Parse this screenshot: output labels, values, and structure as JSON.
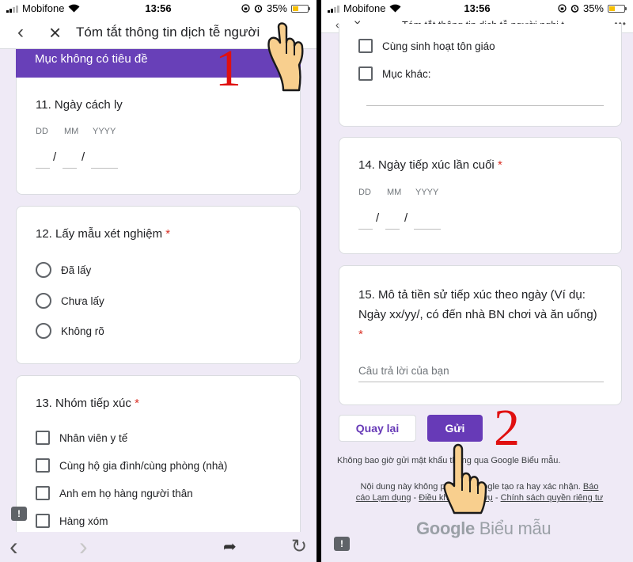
{
  "status_bar": {
    "carrier": "Mobifone",
    "time": "13:56",
    "battery": "35%",
    "battery_level": 0.35
  },
  "left": {
    "nav_title": "Tóm tắt thông tin dịch tễ người",
    "section_title": "Mục không có tiêu đề",
    "q11": {
      "title": "11. Ngày cách ly",
      "dd": "DD",
      "mm": "MM",
      "yyyy": "YYYY"
    },
    "q12": {
      "title": "12. Lấy mẫu xét nghiệm",
      "required": "*",
      "options": [
        "Đã lấy",
        "Chưa lấy",
        "Không rõ"
      ]
    },
    "q13": {
      "title": "13. Nhóm tiếp xúc",
      "required": "*",
      "options": [
        "Nhân viên y tế",
        "Cùng hộ gia đình/cùng phòng (nhà)",
        "Anh em họ hàng người thân",
        "Hàng xóm"
      ]
    },
    "toolbar": {
      "back": "‹",
      "forward": "›",
      "share": "➦",
      "reload": "↻"
    }
  },
  "right": {
    "nav_title": "Tóm tắt thông tin dịch tễ người nghi t...",
    "more": "•••",
    "q13_options": [
      "Cùng sinh hoạt tôn giáo",
      "Mục khác:"
    ],
    "q14": {
      "title": "14. Ngày tiếp xúc lần cuối",
      "required": "*",
      "dd": "DD",
      "mm": "MM",
      "yyyy": "YYYY"
    },
    "q15": {
      "title_line1": "15. Mô tả tiền sử tiếp xúc theo ngày (Ví dụ:",
      "title_line2": "Ngày xx/yy/, có đến nhà BN chơi và ăn uống)",
      "required": "*",
      "placeholder": "Câu trả lời của bạn"
    },
    "back_button": "Quay lại",
    "submit_button": "Gửi",
    "footer_notice": "Không bao giờ gửi mật khẩu thông qua Google Biểu mẫu.",
    "footer_disclaimer": "Nội dung này không phải do Google tạo ra hay xác nhận.",
    "footer_links": [
      "Báo cáo Lạm dụng",
      "Điều khoản dịch vụ",
      "Chính sách quyền riêng tư"
    ],
    "logo_google": "Google",
    "logo_product": "Biểu mẫu"
  },
  "annotations": {
    "step1": "1",
    "step2": "2"
  },
  "colors": {
    "accent": "#673ab7",
    "header": "#6840b8",
    "required": "#d93025",
    "annotation": "#e01010",
    "background": "#efeaf6"
  }
}
